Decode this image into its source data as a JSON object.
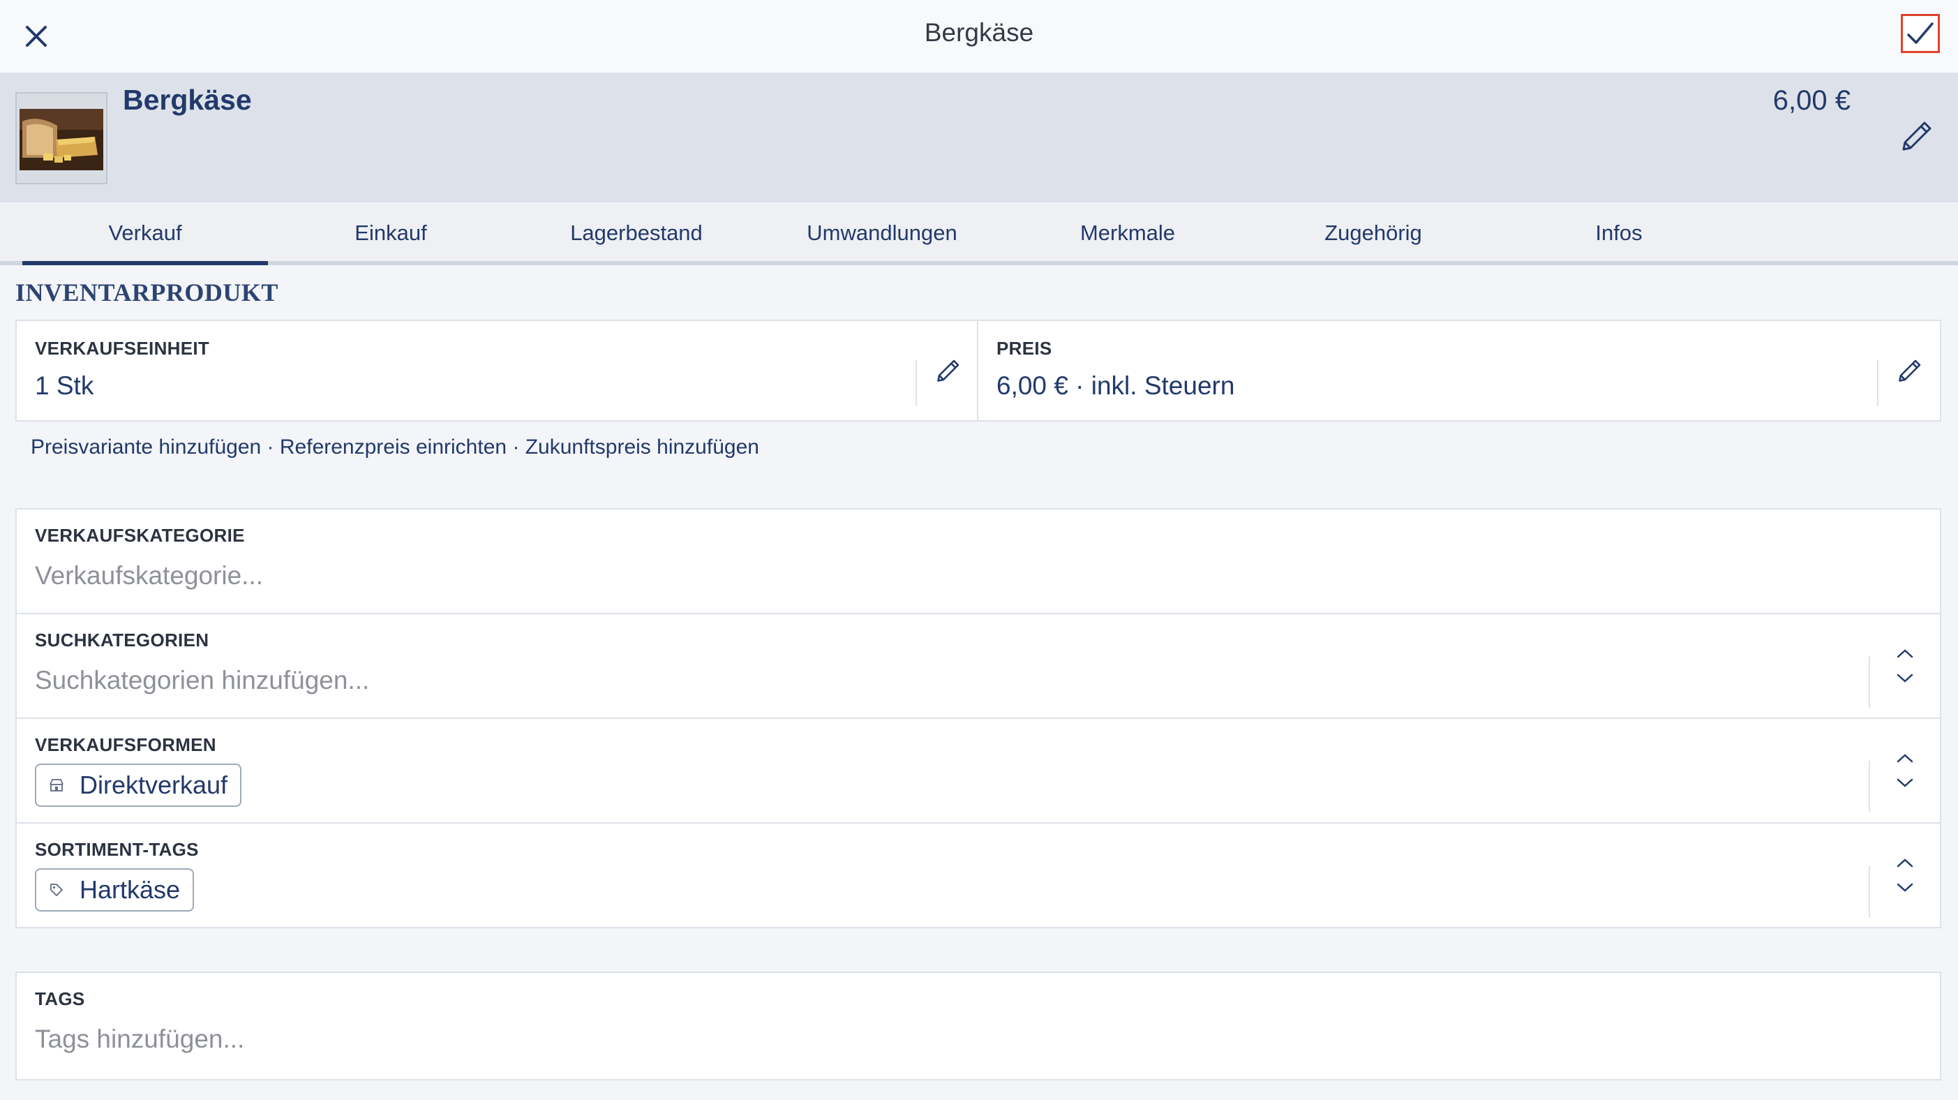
{
  "window": {
    "title": "Bergkäse"
  },
  "product": {
    "name": "Bergkäse",
    "price": "6,00 €",
    "thumbnail_icon": "cheese-photo"
  },
  "tabs": [
    {
      "label": "Verkauf",
      "active": true
    },
    {
      "label": "Einkauf",
      "active": false
    },
    {
      "label": "Lagerbestand",
      "active": false
    },
    {
      "label": "Umwandlungen",
      "active": false
    },
    {
      "label": "Merkmale",
      "active": false
    },
    {
      "label": "Zugehörig",
      "active": false
    },
    {
      "label": "Infos",
      "active": false
    }
  ],
  "section": {
    "title": "INVENTARPRODUKT"
  },
  "unit": {
    "label": "VERKAUFSEINHEIT",
    "value": "1 Stk"
  },
  "price": {
    "label": "PREIS",
    "value": "6,00 € · inkl. Steuern"
  },
  "links": {
    "add_variant": "Preisvariante hinzufügen",
    "separator": " · ",
    "reference_price": "Referenzpreis einrichten",
    "future_price": "Zukunftspreis hinzufügen"
  },
  "sales_category": {
    "label": "VERKAUFSKATEGORIE",
    "placeholder": "Verkaufskategorie..."
  },
  "search_categories": {
    "label": "SUCHKATEGORIEN",
    "placeholder": "Suchkategorien hinzufügen..."
  },
  "sales_forms": {
    "label": "VERKAUFSFORMEN",
    "chip": "Direktverkauf"
  },
  "assortment_tags": {
    "label": "SORTIMENT-TAGS",
    "chip": "Hartkäse"
  },
  "tags": {
    "label": "TAGS",
    "placeholder": "Tags hinzufügen..."
  },
  "colors": {
    "accent": "#22396b",
    "confirm_highlight": "#e0412c",
    "header_bg": "#dde2ea"
  }
}
